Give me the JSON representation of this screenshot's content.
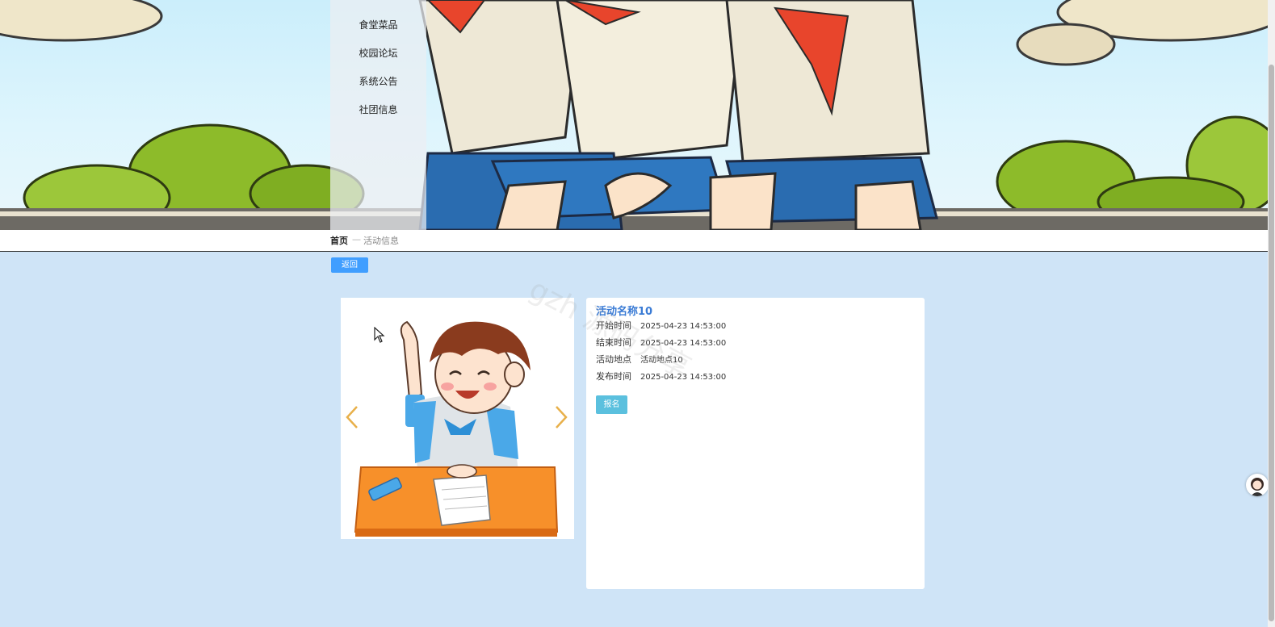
{
  "menu": {
    "items": [
      {
        "label": "食堂菜品"
      },
      {
        "label": "校园论坛"
      },
      {
        "label": "系统公告"
      },
      {
        "label": "社团信息"
      }
    ]
  },
  "breadcrumb": {
    "home": "首页",
    "separator": "—",
    "current": "活动信息"
  },
  "back_button": "返回",
  "activity": {
    "title": "活动名称10",
    "fields": [
      {
        "label": "开始时间",
        "value": "2025-04-23 14:53:00"
      },
      {
        "label": "结束时间",
        "value": "2025-04-23 14:53:00"
      },
      {
        "label": "活动地点",
        "value": "活动地点10"
      },
      {
        "label": "发布时间",
        "value": "2025-04-23 14:53:00"
      }
    ],
    "signup_button": "报名"
  },
  "watermark": "gzh 源码分享",
  "icons": {
    "prev": "chevron-left-icon",
    "next": "chevron-right-icon",
    "avatar": "avatar-icon",
    "cursor": "mouse-cursor-icon"
  },
  "colors": {
    "page_bg": "#cfe4f7",
    "accent": "#409eff",
    "signup": "#5bc0de",
    "title": "#3a7bd5",
    "arrow": "#e8b04a"
  }
}
